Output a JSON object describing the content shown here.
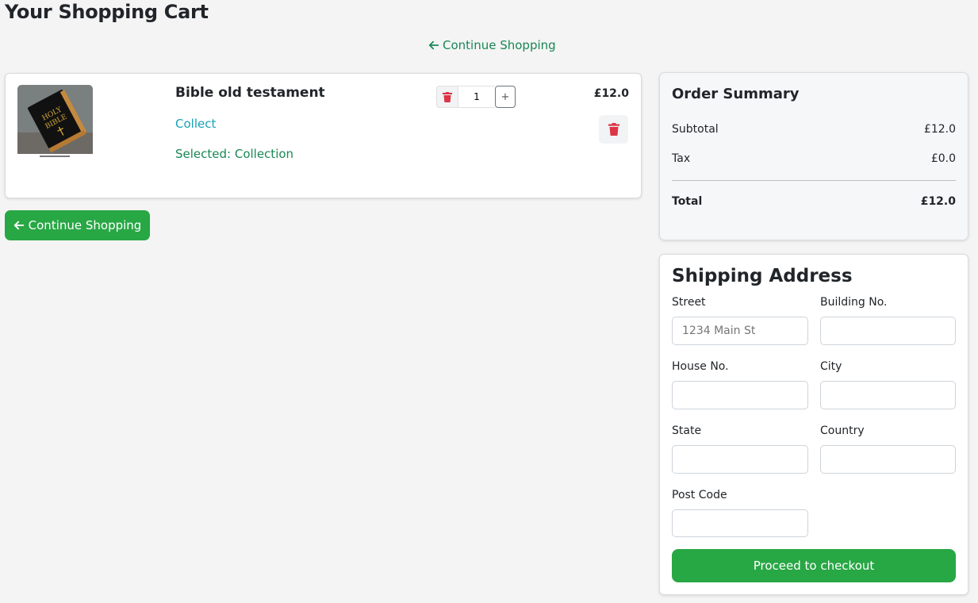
{
  "page": {
    "title": "Your Shopping Cart"
  },
  "top_link": {
    "label": "Continue Shopping"
  },
  "cart": {
    "item": {
      "name": "Bible old testament",
      "collect_label": "Collect",
      "selected_label": "Selected: Collection",
      "quantity": "1",
      "plus_label": "+",
      "price": "£12.0",
      "image_icon": "bible-book-image"
    }
  },
  "continue_button": {
    "label": "Continue Shopping"
  },
  "summary": {
    "title": "Order Summary",
    "subtotal_label": "Subtotal",
    "subtotal_value": "£12.0",
    "tax_label": "Tax",
    "tax_value": "£0.0",
    "total_label": "Total",
    "total_value": "£12.0"
  },
  "shipping": {
    "title": "Shipping Address",
    "street_label": "Street",
    "street_placeholder": "1234 Main St",
    "building_label": "Building No.",
    "house_label": "House No.",
    "city_label": "City",
    "state_label": "State",
    "country_label": "Country",
    "postcode_label": "Post Code",
    "checkout_label": "Proceed to checkout"
  },
  "colors": {
    "accent_green": "#28a745",
    "link_green": "#198754",
    "link_cyan": "#17a2b8",
    "danger_red": "#dc3545"
  }
}
